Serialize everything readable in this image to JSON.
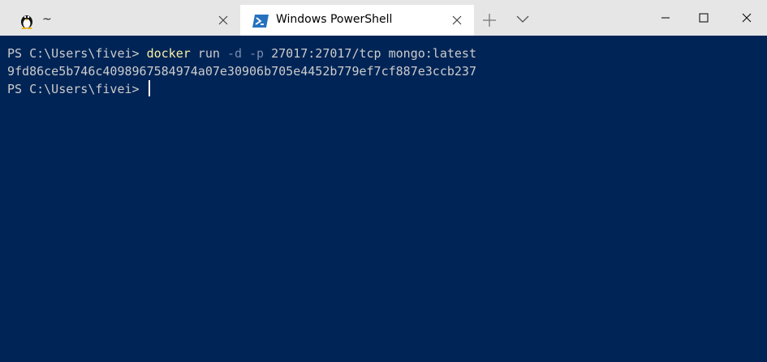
{
  "tabs": [
    {
      "title": "~",
      "icon": "linux-penguin-icon",
      "active": false
    },
    {
      "title": "Windows PowerShell",
      "icon": "powershell-icon",
      "active": true
    }
  ],
  "toolbar": {
    "new_tab_icon": "plus-icon",
    "dropdown_icon": "chevron-down-icon"
  },
  "window_controls": {
    "minimize_icon": "minimize-icon",
    "maximize_icon": "maximize-icon",
    "close_icon": "close-icon"
  },
  "terminal": {
    "line1": {
      "prompt": "PS C:\\Users\\fivei> ",
      "command": "docker",
      "args1": " run ",
      "flag1": "-d",
      "space": " ",
      "flag2": "-p",
      "args2": " 27017:27017/tcp mongo:latest"
    },
    "line2": {
      "output": "9fd86ce5b746c4098967584974a07e30906b705e4452b779ef7cf887e3ccb237"
    },
    "line3": {
      "prompt": "PS C:\\Users\\fivei> "
    }
  },
  "colors": {
    "background": "#012456",
    "command": "#f9f1a5",
    "parameter": "#7a8bae",
    "text": "#cccccc"
  }
}
